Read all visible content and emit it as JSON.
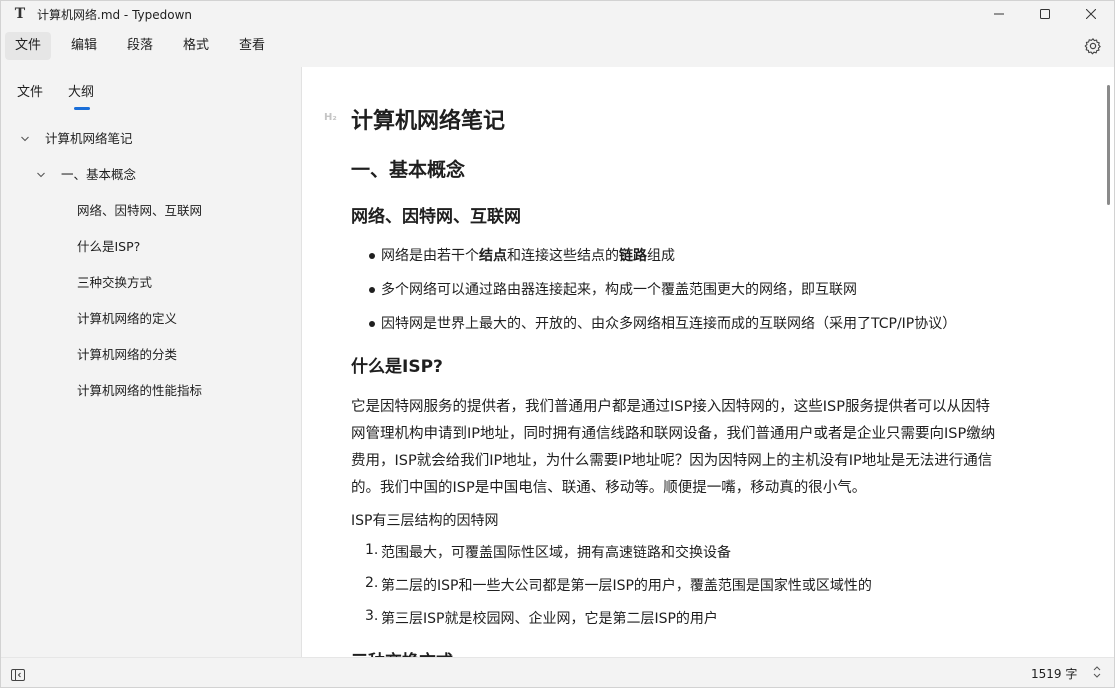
{
  "window": {
    "app_icon": "T",
    "title": "计算机网络.md - Typedown"
  },
  "menubar": {
    "items": [
      "文件",
      "编辑",
      "段落",
      "格式",
      "查看"
    ]
  },
  "sidebar": {
    "tabs": [
      "文件",
      "大纲"
    ],
    "active_tab": "大纲",
    "outline": [
      {
        "label": "计算机网络笔记",
        "level": 1,
        "expanded": true
      },
      {
        "label": "一、基本概念",
        "level": 2,
        "expanded": true
      },
      {
        "label": "网络、因特网、互联网",
        "level": 3
      },
      {
        "label": "什么是ISP?",
        "level": 3
      },
      {
        "label": "三种交换方式",
        "level": 3
      },
      {
        "label": "计算机网络的定义",
        "level": 3
      },
      {
        "label": "计算机网络的分类",
        "level": 3
      },
      {
        "label": "计算机网络的性能指标",
        "level": 3
      }
    ]
  },
  "editor": {
    "heading_marker": "H₂",
    "h1": "计算机网络笔记",
    "h2": "一、基本概念",
    "section1": {
      "title": "网络、因特网、互联网",
      "bullets": [
        {
          "pre": "网络是由若干个",
          "b1": "结点",
          "mid": "和连接这些结点的",
          "b2": "链路",
          "post": "组成"
        },
        {
          "text": "多个网络可以通过路由器连接起来，构成一个覆盖范围更大的网络，即互联网"
        },
        {
          "text": "因特网是世界上最大的、开放的、由众多网络相互连接而成的互联网络（采用了TCP/IP协议）"
        }
      ]
    },
    "section2": {
      "title": "什么是ISP?",
      "paragraph_lines": [
        "它是因特网服务的提供者，我们普通用户都是通过ISP接入因特网的，这些ISP服务提供者可以从因特",
        "网管理机构申请到IP地址，同时拥有通信线路和联网设备，我们普通用户或者是企业只需要向ISP缴纳",
        "费用，ISP就会给我们IP地址，为什么需要IP地址呢？因为因特网上的主机没有IP地址是无法进行通信",
        "的。我们中国的ISP是中国电信、联通、移动等。顺便提一嘴，移动真的很小气。"
      ],
      "structure_intro": "ISP有三层结构的因特网",
      "ordered": [
        {
          "num": "1.",
          "text": "范围最大，可覆盖国际性区域，拥有高速链路和交换设备"
        },
        {
          "num": "2.",
          "text": "第二层的ISP和一些大公司都是第一层ISP的用户，覆盖范围是国家性或区域性的"
        },
        {
          "num": "3.",
          "text": "第三层ISP就是校园网、企业网，它是第二层ISP的用户"
        }
      ]
    },
    "section3_title": "三种交换方式"
  },
  "statusbar": {
    "word_count": "1519 字"
  }
}
